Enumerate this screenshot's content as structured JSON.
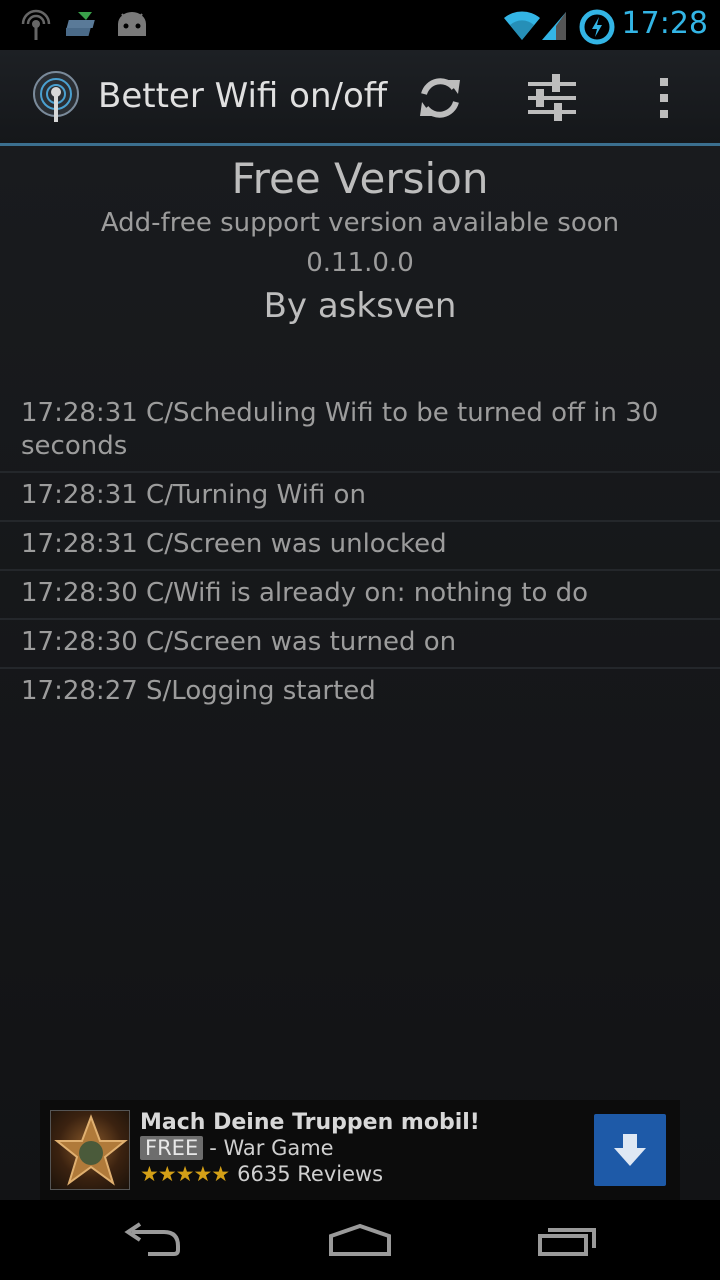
{
  "status_bar": {
    "time": "17:28",
    "icons": [
      "signal-hotspot-icon",
      "stack-icon",
      "android-icon",
      "wifi-icon",
      "cell-signal-icon",
      "battery-charging-icon"
    ]
  },
  "action_bar": {
    "app_title": "Better Wifi on/off",
    "actions": [
      "refresh-icon",
      "settings-sliders-icon",
      "overflow-menu-icon"
    ]
  },
  "header": {
    "title": "Free Version",
    "subtitle": "Add-free support version available soon",
    "version": "0.11.0.0",
    "author": "By asksven"
  },
  "log": [
    "17:28:31 C/Scheduling Wifi to be turned off in 30 seconds",
    "17:28:31 C/Turning Wifi on",
    "17:28:31 C/Screen was unlocked",
    "17:28:30 C/Wifi is already on: nothing to do",
    "17:28:30 C/Screen was turned on",
    "17:28:27 S/Logging started"
  ],
  "ad": {
    "title": "Mach Deine Truppen mobil!",
    "badge": "FREE",
    "category": "- War Game",
    "rating": 4.5,
    "stars": "★★★★★",
    "reviews": "6635 Reviews"
  },
  "nav": [
    "back-icon",
    "home-icon",
    "recent-apps-icon"
  ],
  "colors": {
    "accent": "#33b5e5",
    "divider": "#3b6f8f",
    "ad_button": "#1e5aa8"
  }
}
